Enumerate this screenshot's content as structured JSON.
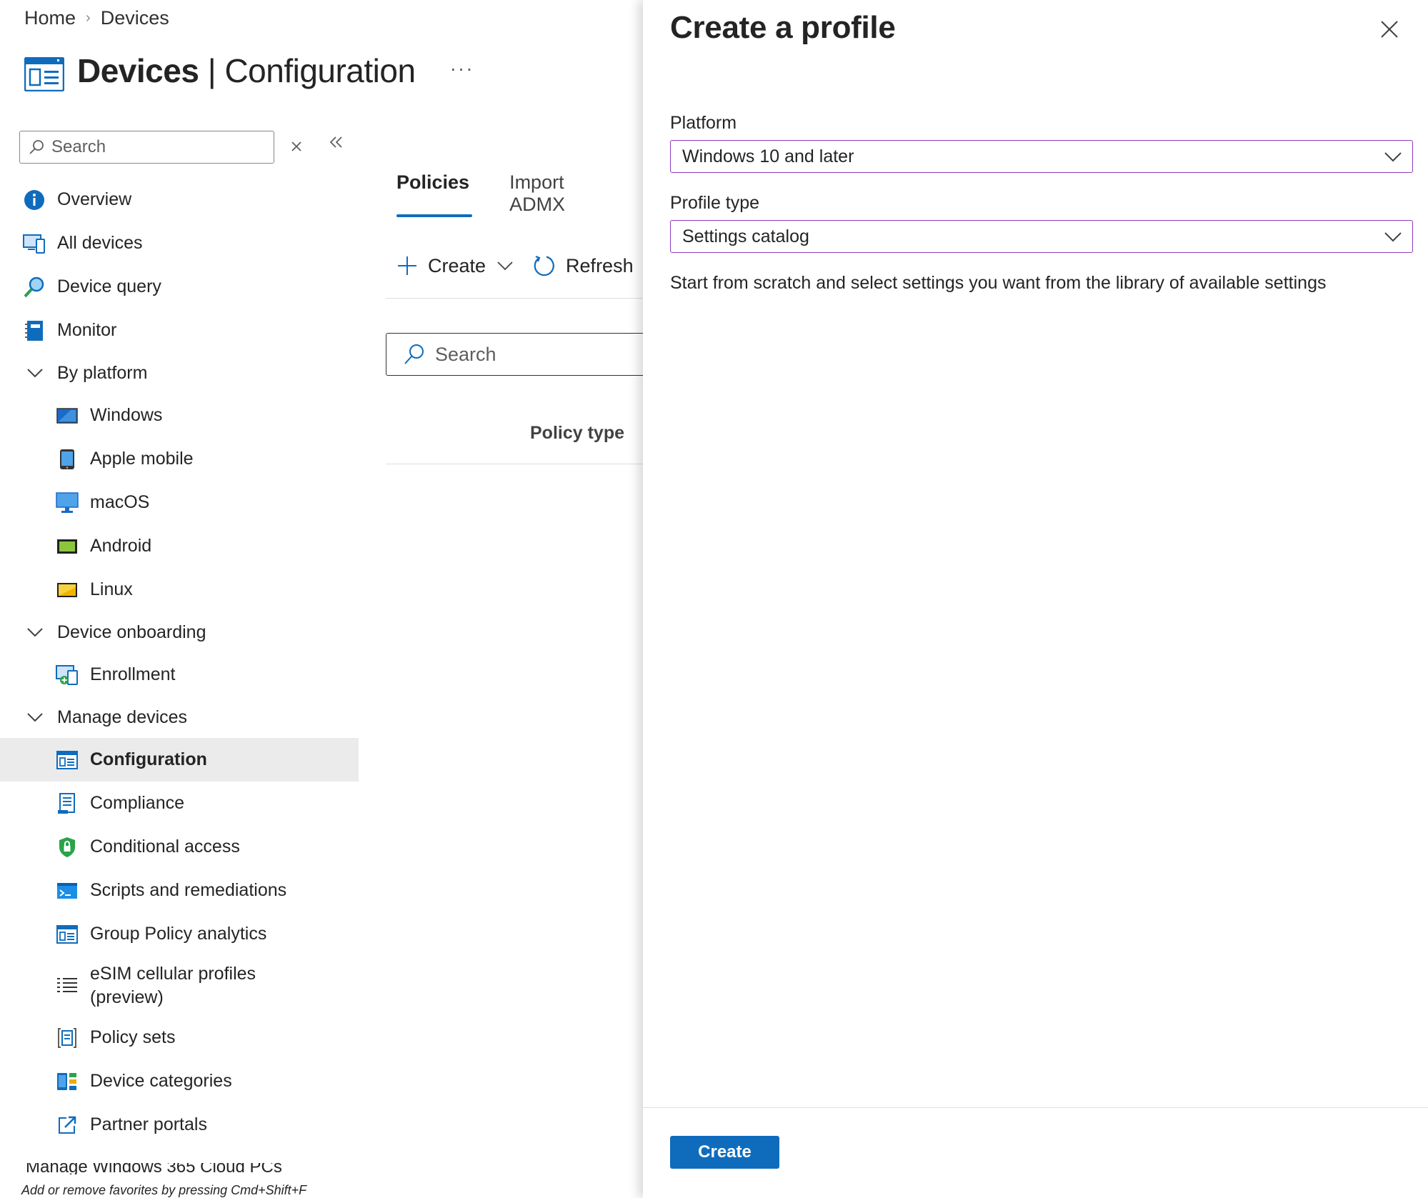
{
  "breadcrumb": {
    "home": "Home",
    "separator": "›",
    "current": "Devices"
  },
  "page": {
    "title_bold": "Devices",
    "title_sep": " | ",
    "title_rest": "Configuration",
    "more": "···"
  },
  "nav_search": {
    "placeholder": "Search"
  },
  "nav": {
    "overview": "Overview",
    "all_devices": "All devices",
    "device_query": "Device query",
    "monitor": "Monitor",
    "by_platform": "By platform",
    "windows": "Windows",
    "apple_mobile": "Apple mobile",
    "macos": "macOS",
    "android": "Android",
    "linux": "Linux",
    "device_onboarding": "Device onboarding",
    "enrollment": "Enrollment",
    "manage_devices": "Manage devices",
    "configuration": "Configuration",
    "compliance": "Compliance",
    "conditional_access": "Conditional access",
    "scripts": "Scripts and remediations",
    "gp_analytics": "Group Policy analytics",
    "esim_line1": "eSIM cellular profiles",
    "esim_line2": "(preview)",
    "policy_sets": "Policy sets",
    "device_categories": "Device categories",
    "partner_portals": "Partner portals",
    "cut_item": "Manage Windows 365 Cloud PCs"
  },
  "footer_hint": "Add or remove favorites by pressing Cmd+Shift+F",
  "tabs": {
    "policies": "Policies",
    "import_admx": "Import ADMX"
  },
  "toolbar": {
    "create": "Create",
    "refresh": "Refresh"
  },
  "main_search": {
    "placeholder": "Search"
  },
  "table": {
    "col_policy_type": "Policy type"
  },
  "panel": {
    "title": "Create a profile",
    "platform_label": "Platform",
    "platform_value": "Windows 10 and later",
    "profile_type_label": "Profile type",
    "profile_type_value": "Settings catalog",
    "description": "Start from scratch and select settings you want from the library of available settings",
    "create_button": "Create"
  },
  "colors": {
    "accent": "#0f6cbd",
    "dropdown_border": "#8c3bbf",
    "active_nav_bg": "#ebebeb"
  }
}
